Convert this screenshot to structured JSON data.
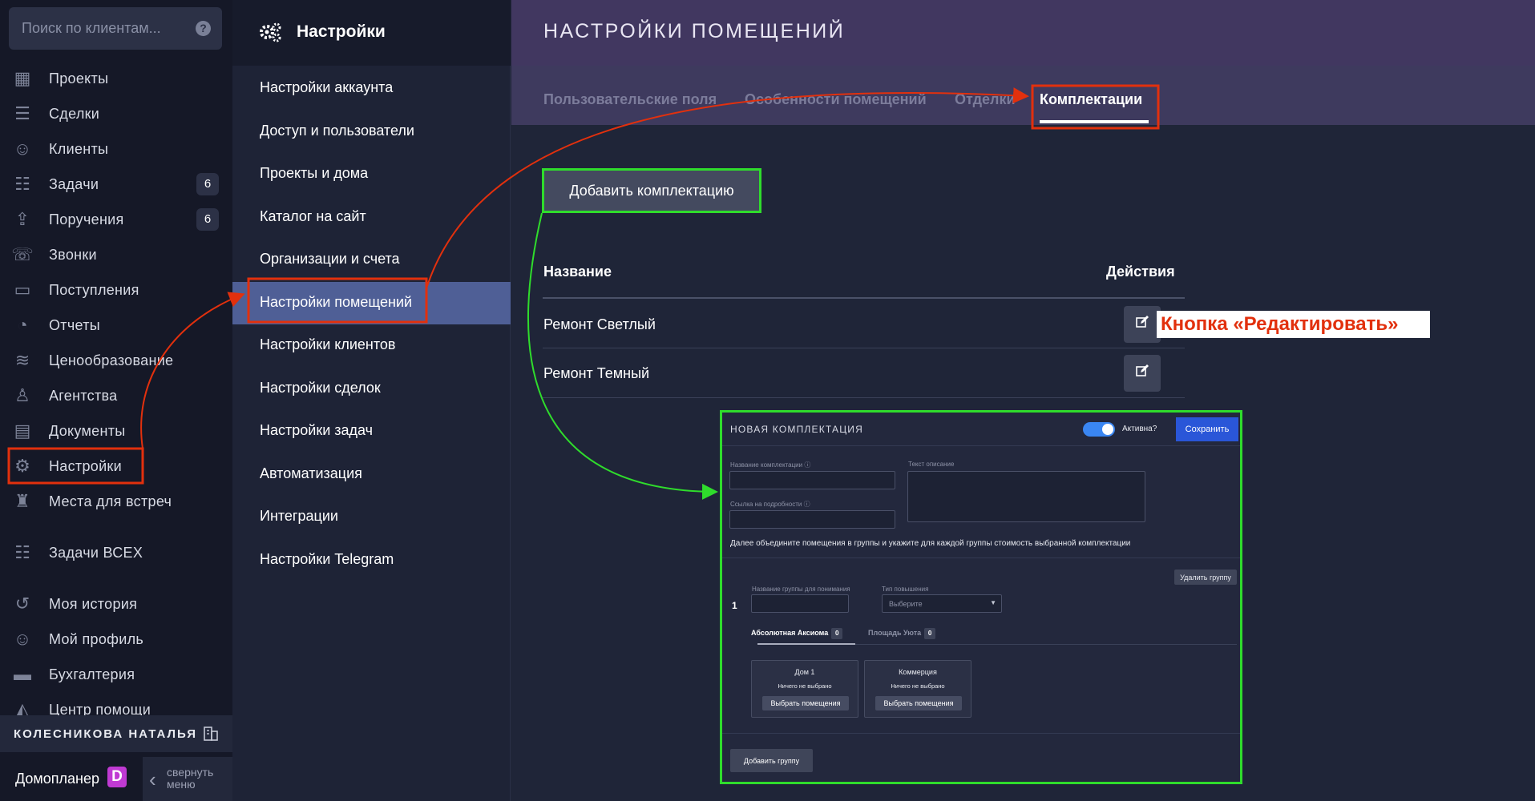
{
  "search": {
    "placeholder": "Поиск по клиентам...",
    "help": "?"
  },
  "nav": {
    "items": [
      {
        "label": "Проекты",
        "icon": "buildings-icon",
        "glyph": "▦",
        "count": ""
      },
      {
        "label": "Сделки",
        "icon": "handshake-icon",
        "glyph": "☰",
        "count": ""
      },
      {
        "label": "Клиенты",
        "icon": "users-icon",
        "glyph": "☺",
        "count": ""
      },
      {
        "label": "Задачи",
        "icon": "checklist-icon",
        "glyph": "☷",
        "count": "6"
      },
      {
        "label": "Поручения",
        "icon": "upload-icon",
        "glyph": "⇪",
        "count": "6"
      },
      {
        "label": "Звонки",
        "icon": "headset-icon",
        "glyph": "☏",
        "count": ""
      },
      {
        "label": "Поступления",
        "icon": "wallet-icon",
        "glyph": "▭",
        "count": ""
      },
      {
        "label": "Отчеты",
        "icon": "pie-chart-icon",
        "glyph": "◔",
        "count": ""
      },
      {
        "label": "Ценообразование",
        "icon": "coins-icon",
        "glyph": "≋",
        "count": ""
      },
      {
        "label": "Агентства",
        "icon": "agent-icon",
        "glyph": "♙",
        "count": ""
      },
      {
        "label": "Документы",
        "icon": "documents-icon",
        "glyph": "▤",
        "count": ""
      },
      {
        "label": "Настройки",
        "icon": "gear-icon",
        "glyph": "⚙",
        "count": ""
      },
      {
        "label": "Места для встреч",
        "icon": "meeting-place-icon",
        "glyph": "♜",
        "count": ""
      },
      {
        "label": "Задачи ВСЕХ",
        "icon": "all-tasks-icon",
        "glyph": "☷",
        "count": ""
      },
      {
        "label": "Моя история",
        "icon": "history-icon",
        "glyph": "↺",
        "count": ""
      },
      {
        "label": "Мой профиль",
        "icon": "profile-icon",
        "glyph": "☺",
        "count": ""
      },
      {
        "label": "Бухгалтерия",
        "icon": "accounting-icon",
        "glyph": "▬",
        "count": ""
      },
      {
        "label": "Центр помощи",
        "icon": "help-center-icon",
        "glyph": "◭",
        "count": ""
      }
    ]
  },
  "user": {
    "name": "КОЛЕСНИКОВА НАТАЛЬЯ"
  },
  "brand": {
    "name": "Домопланер",
    "logo": "D"
  },
  "collapse": {
    "label": "свернуть меню"
  },
  "settings_menu": {
    "title": "Настройки",
    "items": [
      "Настройки аккаунта",
      "Доступ и пользователи",
      "Проекты и дома",
      "Каталог на сайт",
      "Организации и счета",
      "Настройки помещений",
      "Настройки клиентов",
      "Настройки сделок",
      "Настройки задач",
      "Автоматизация",
      "Интеграции",
      "Настройки Telegram"
    ],
    "active_index": 5
  },
  "page": {
    "title": "НАСТРОЙКИ ПОМЕЩЕНИЙ",
    "tabs": [
      "Пользовательские поля",
      "Особенности помещений",
      "Отделки",
      "Комплектации"
    ],
    "active_tab": "Комплектации"
  },
  "table": {
    "add_button": "Добавить комплектацию",
    "columns": [
      "Название",
      "Действия"
    ],
    "rows": [
      {
        "name": "Ремонт Светлый"
      },
      {
        "name": "Ремонт Темный"
      }
    ]
  },
  "annotation": {
    "edit_callout": "Кнопка «Редактировать»",
    "red": "#e2300d",
    "green": "#2fdc2c"
  },
  "modal": {
    "title": "НОВАЯ КОМПЛЕКТАЦИЯ",
    "active_label": "Активна?",
    "save_button": "Сохранить",
    "name_label": "Название комплектации",
    "link_label": "Ссылка на подробности",
    "desc_label": "Текст описание",
    "note": "Далее объедините помещения в группы и укажите для каждой группы стоимость выбранной комплектации",
    "delete_group": "Удалить группу",
    "group_number": "1",
    "group_name_label": "Название группы для понимания",
    "raise_type_label": "Тип повышения",
    "raise_type_value": "Выберите",
    "project_tabs": [
      {
        "label": "Абсолютная Аксиома",
        "count": "0"
      },
      {
        "label": "Площадь Уюта",
        "count": "0"
      }
    ],
    "cards": [
      {
        "name": "Дом 1",
        "status": "Ничего не выбрано",
        "button": "Выбрать помещения"
      },
      {
        "name": "Коммерция",
        "status": "Ничего не выбрано",
        "button": "Выбрать помещения"
      }
    ],
    "add_group": "Добавить группу"
  }
}
